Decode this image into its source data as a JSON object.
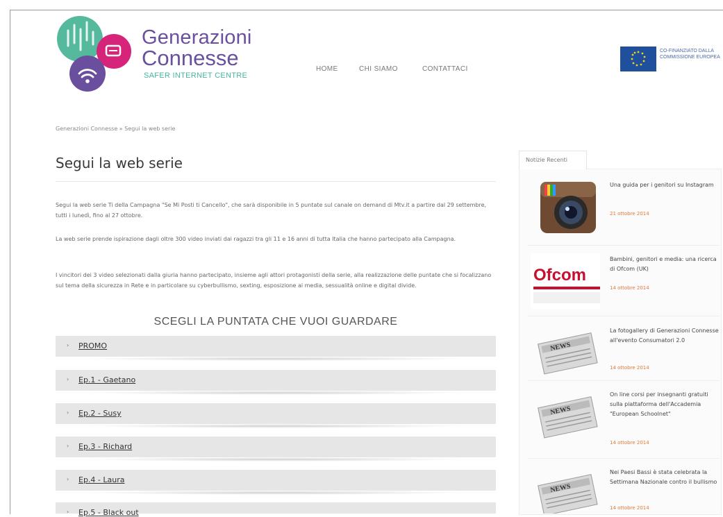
{
  "header": {
    "brand_line1": "Generazioni",
    "brand_line2": "Connesse",
    "brand_line3": "SAFER INTERNET CENTRE",
    "nav": [
      "HOME",
      "CHI SIAMO",
      "CONTATTACI"
    ],
    "eu_text": "CO-FINANZIATO DALLA COMMISSIONE EUROPEA"
  },
  "breadcrumb": "Generazioni Connesse » Segui la web serie",
  "main": {
    "title": "Segui la web serie",
    "paragraphs": [
      "Segui la web serie Ti della Campagna \"Se Mi Posti ti Cancello\", che sarà disponibile in 5 puntate sul canale on demand di Mtv.it a partire dal 29 settembre, tutti i lunedì, fino al 27 ottobre.",
      "La web serie prende ispirazione dagli oltre 300 video inviati dai ragazzi tra gli 11 e 16 anni di tutta Italia che hanno partecipato alla Campagna.",
      "I vincitori dei 3 video selezionati dalla giuria hanno partecipato, insieme agli attori protagonisti della serie, alla realizzazione delle puntate che si focalizzano sul tema della sicurezza in Rete e in particolare su cyberbullismo, sexting, esposizione ai media, sessualità online e digital divide."
    ],
    "choose_heading": "SCEGLI LA PUNTATA CHE VUOI GUARDARE",
    "episodes": [
      "PROMO",
      "Ep.1 - Gaetano",
      "Ep.2 - Susy",
      "Ep.3 - Richard",
      "Ep.4 - Laura",
      "Ep.5 - Black out"
    ],
    "arrow": "›"
  },
  "sidebar": {
    "tab_label": "Notizie Recenti",
    "news": [
      {
        "title": "Una guida per i genitori su Instagram",
        "date": "21 ottobre 2014",
        "thumb": "instagram-icon"
      },
      {
        "title": "Bambini, genitori e media: una ricerca di Ofcom (UK)",
        "date": "14 ottobre 2014",
        "thumb": "ofcom-logo",
        "logo_text": "Ofcom"
      },
      {
        "title": "La fotogallery di Generazioni Connesse all'evento Consumatori 2.0",
        "date": "14 ottobre 2014",
        "thumb": "newspaper-icon"
      },
      {
        "title": "On line corsi per insegnanti gratuiti sulla piattaforma dell'Accademia \"European Schoolnet\"",
        "date": "14 ottobre 2014",
        "thumb": "newspaper-icon"
      },
      {
        "title": "Nei Paesi Bassi è stata celebrata la Settimana Nazionale contro il bullismo",
        "date": "14 ottobre 2014",
        "thumb": "newspaper-icon"
      }
    ]
  },
  "colors": {
    "brand_purple": "#6a4f9e",
    "brand_green": "#46b59e",
    "brand_pink": "#d6247a",
    "eu_blue": "#1f4f9d",
    "date_orange": "#e1793a"
  }
}
